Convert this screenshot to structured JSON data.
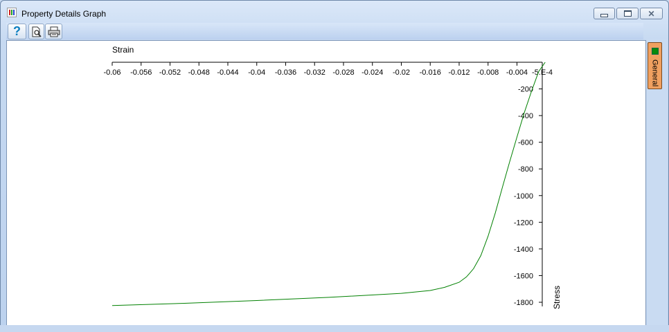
{
  "window": {
    "title": "Property Details Graph",
    "icon": "bar-chart-app-icon",
    "controls": {
      "minimize": "minimize-icon",
      "maximize": "maximize-icon",
      "close": "✕"
    }
  },
  "toolbar": {
    "help_label": "?",
    "help_icon": "help-icon",
    "preview_icon": "print-preview-icon",
    "print_icon": "print-icon"
  },
  "side_tabs": [
    {
      "label": "General",
      "color": "#f0a060",
      "swatch": "#0a8a0a"
    }
  ],
  "chart_data": {
    "type": "line",
    "xlabel": "Strain",
    "ylabel": "Stress",
    "x_ticks": [
      "-0.06",
      "-0.056",
      "-0.052",
      "-0.048",
      "-0.044",
      "-0.04",
      "-0.036",
      "-0.032",
      "-0.028",
      "-0.024",
      "-0.02",
      "-0.016",
      "-0.012",
      "-0.008",
      "-0.004",
      "-5.E-4"
    ],
    "y_ticks": [
      "-200",
      "-400",
      "-600",
      "-800",
      "-1000",
      "-1200",
      "-1400",
      "-1600",
      "-1800"
    ],
    "xlim": [
      -0.06,
      -0.0001
    ],
    "ylim": [
      -1850,
      0
    ],
    "axis_position": "x-axis top, y-axis right",
    "grid": false,
    "series": [
      {
        "color": "#008000",
        "x": [
          -0.06,
          -0.05,
          -0.04,
          -0.03,
          -0.02,
          -0.016,
          -0.014,
          -0.012,
          -0.011,
          -0.0105,
          -0.01,
          -0.009,
          -0.008,
          -0.007,
          -0.006,
          -0.005,
          -0.004,
          -0.003,
          -0.002,
          -0.001,
          -0.0001
        ],
        "y": [
          -1825,
          -1808,
          -1787,
          -1763,
          -1733,
          -1712,
          -1688,
          -1650,
          -1610,
          -1580,
          -1548,
          -1450,
          -1305,
          -1130,
          -935,
          -745,
          -560,
          -380,
          -220,
          -70,
          0
        ]
      }
    ]
  }
}
